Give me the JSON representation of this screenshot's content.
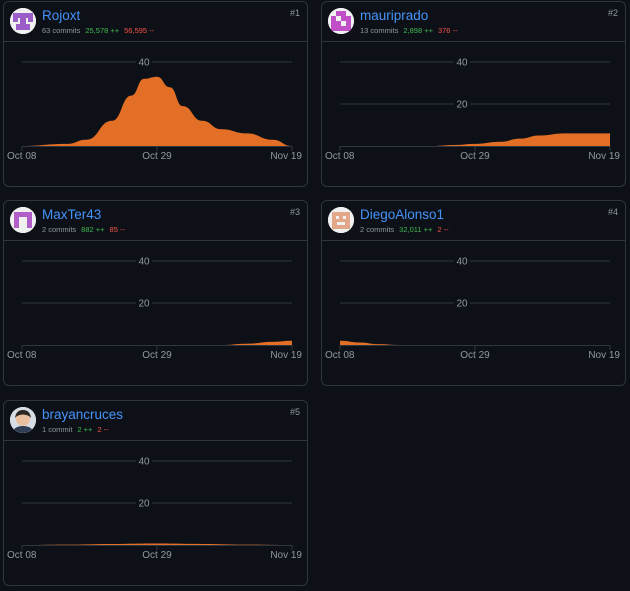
{
  "contributors": [
    {
      "rank": "#1",
      "username": "Rojoxt",
      "commits": "63 commits",
      "additions": "25,578 ++",
      "deletions": "56,595 --",
      "avatar": "identicon-purple-cross-icon",
      "chart_data": {
        "type": "area",
        "x": [
          "Oct 08",
          "Oct 15",
          "Oct 18",
          "Oct 22",
          "Oct 25",
          "Oct 27",
          "Oct 29",
          "Oct 31",
          "Nov 02",
          "Nov 05",
          "Nov 08",
          "Nov 12",
          "Nov 16",
          "Nov 19"
        ],
        "y": [
          0,
          1,
          3,
          12,
          24,
          32,
          33,
          28,
          19,
          12,
          8,
          6,
          3,
          0
        ],
        "ylim": [
          0,
          40
        ],
        "yticks": [
          "40"
        ],
        "xticks": [
          "Oct 08",
          "Oct 29",
          "Nov 19"
        ],
        "color": "#e36e25"
      }
    },
    {
      "rank": "#2",
      "username": "mauriprado",
      "commits": "13 commits",
      "additions": "2,898 ++",
      "deletions": "376 --",
      "avatar": "identicon-magenta-checker-icon",
      "chart_data": {
        "type": "area",
        "x": [
          "Oct 22",
          "Oct 26",
          "Oct 29",
          "Nov 02",
          "Nov 05",
          "Nov 08",
          "Nov 12",
          "Nov 16",
          "Nov 19"
        ],
        "y": [
          0,
          0.5,
          1,
          2,
          3.5,
          5,
          6,
          6,
          6
        ],
        "ylim": [
          0,
          40
        ],
        "yticks": [
          "40",
          "20"
        ],
        "xticks": [
          "Oct 08",
          "Oct 29",
          "Nov 19"
        ],
        "color": "#e36e25"
      }
    },
    {
      "rank": "#3",
      "username": "MaxTer43",
      "commits": "2 commits",
      "additions": "882 ++",
      "deletions": "85 --",
      "avatar": "identicon-purple-block-icon",
      "chart_data": {
        "type": "area",
        "x": [
          "Nov 08",
          "Nov 12",
          "Nov 16",
          "Nov 19"
        ],
        "y": [
          0,
          0.6,
          1.5,
          2
        ],
        "ylim": [
          0,
          40
        ],
        "yticks": [
          "40",
          "20"
        ],
        "xticks": [
          "Oct 08",
          "Oct 29",
          "Nov 19"
        ],
        "color": "#e36e25"
      }
    },
    {
      "rank": "#4",
      "username": "DiegoAlonso1",
      "commits": "2 commits",
      "additions": "32,011 ++",
      "deletions": "2 --",
      "avatar": "identicon-orange-face-icon",
      "chart_data": {
        "type": "area",
        "x": [
          "Oct 08",
          "Oct 11",
          "Oct 14",
          "Oct 17"
        ],
        "y": [
          2,
          1.2,
          0.4,
          0
        ],
        "ylim": [
          0,
          40
        ],
        "yticks": [
          "40",
          "20"
        ],
        "xticks": [
          "Oct 08",
          "Oct 29",
          "Nov 19"
        ],
        "color": "#e36e25"
      }
    },
    {
      "rank": "#5",
      "username": "brayancruces",
      "commits": "1 commit",
      "additions": "2 ++",
      "deletions": "2 --",
      "avatar": "photo-avatar-icon",
      "chart_data": {
        "type": "area",
        "x": [
          "Oct 08",
          "Oct 15",
          "Oct 22",
          "Oct 29",
          "Nov 05",
          "Nov 12",
          "Nov 19"
        ],
        "y": [
          0,
          0.2,
          0.5,
          0.7,
          0.5,
          0.2,
          0
        ],
        "ylim": [
          0,
          40
        ],
        "yticks": [
          "40",
          "20"
        ],
        "xticks": [
          "Oct 08",
          "Oct 29",
          "Nov 19"
        ],
        "color": "#e36e25"
      }
    }
  ]
}
